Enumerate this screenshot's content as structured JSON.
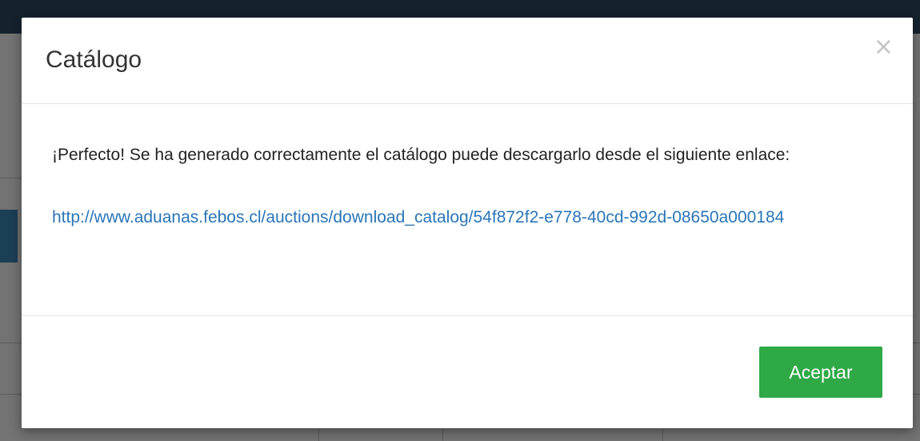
{
  "modal": {
    "title": "Catálogo",
    "close_symbol": "×",
    "message": "¡Perfecto! Se ha generado correctamente el catálogo puede descargarlo desde el siguiente enlace:",
    "link_text": "http://www.aduanas.febos.cl/auctions/download_catalog/54f872f2-e778-40cd-992d-08650a000184",
    "accept_label": "Aceptar"
  },
  "colors": {
    "accept_button": "#2fa846",
    "link": "#2a76b7",
    "topbar": "#2f4d66"
  }
}
